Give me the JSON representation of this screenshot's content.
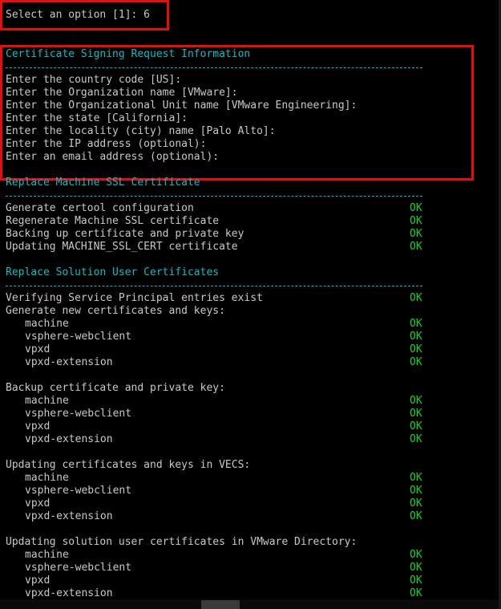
{
  "prompt": "Select an option [1]: 6",
  "csr": {
    "title": "Certificate Signing Request Information",
    "rule": "--------------------------------------------------------------------",
    "lines": [
      "Enter the country code [US]:",
      "Enter the Organization name [VMware]:",
      "Enter the Organizational Unit name [VMware Engineering]:",
      "Enter the state [California]:",
      "Enter the locality (city) name [Palo Alto]:",
      "Enter the IP address (optional):",
      "Enter an email address (optional):"
    ]
  },
  "ok_label": "OK",
  "machine_ssl": {
    "title": "Replace Machine SSL Certificate",
    "steps": [
      "Generate certool configuration",
      "Regenerate Machine SSL certificate",
      "Backing up certificate and private key",
      "Updating MACHINE_SSL_CERT certificate"
    ]
  },
  "solution_users": {
    "title": "Replace Solution User Certificates",
    "verify": "Verifying Service Principal entries exist",
    "groups": [
      {
        "heading": "Generate new certificates and keys:",
        "items": [
          "machine",
          "vsphere-webclient",
          "vpxd",
          "vpxd-extension"
        ]
      },
      {
        "heading": "Backup certificate and private key:",
        "items": [
          "machine",
          "vsphere-webclient",
          "vpxd",
          "vpxd-extension"
        ]
      },
      {
        "heading": "Updating certificates and keys in VECS:",
        "items": [
          "machine",
          "vsphere-webclient",
          "vpxd",
          "vpxd-extension"
        ]
      },
      {
        "heading": "Updating solution user certificates in VMware Directory:",
        "items": [
          "machine",
          "vsphere-webclient",
          "vpxd",
          "vpxd-extension"
        ]
      }
    ]
  },
  "colors": {
    "background": "#000000",
    "text": "#c8c8c8",
    "section_heading": "#18b8c0",
    "ok_status": "#22cc22",
    "highlight_box": "#e01010"
  }
}
